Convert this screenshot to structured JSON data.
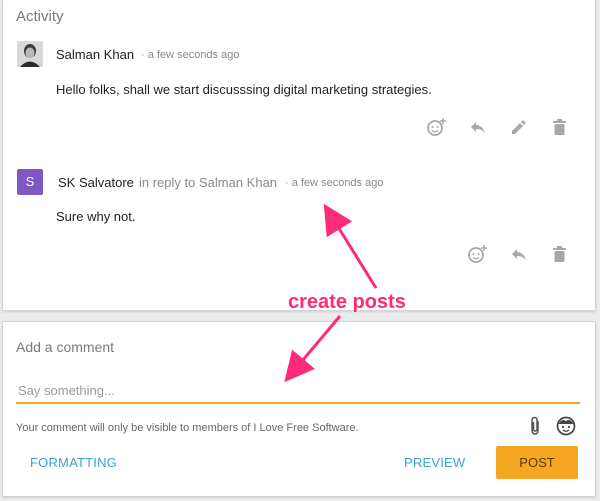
{
  "activity": {
    "title": "Activity",
    "posts": [
      {
        "author": "Salman Khan",
        "timestamp": "a few seconds ago",
        "body": "Hello folks, shall we start discusssing digital marketing strategies.",
        "actions": [
          "add-reaction-icon",
          "reply-icon",
          "edit-icon",
          "delete-icon"
        ]
      },
      {
        "author": "SK Salvatore",
        "avatar_letter": "S",
        "reply_prefix": "in reply to Salman Khan",
        "timestamp": "a few seconds ago",
        "body": "Sure why not.",
        "actions": [
          "add-reaction-icon",
          "reply-icon",
          "delete-icon"
        ]
      }
    ]
  },
  "annotation": {
    "label": "create posts",
    "color": "#ff2a7a"
  },
  "comment": {
    "title": "Add a comment",
    "placeholder": "Say something...",
    "note": "Your comment will only be visible to members of I Love Free Software.",
    "formatting_label": "FORMATTING",
    "preview_label": "PREVIEW",
    "post_label": "POST",
    "accent_color": "#f5a623",
    "link_color": "#3aa3d0"
  }
}
